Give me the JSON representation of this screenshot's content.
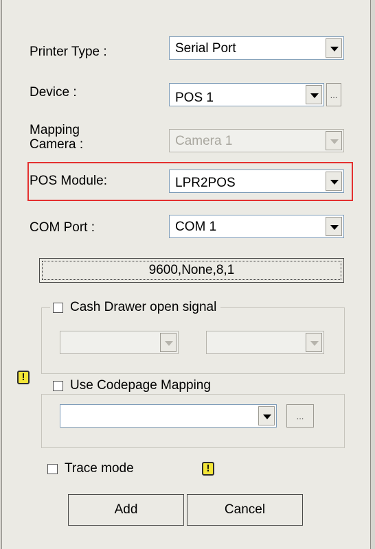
{
  "form": {
    "printer_type": {
      "label": "Printer Type :",
      "value": "Serial Port"
    },
    "device": {
      "label": "Device :",
      "value": "POS 1",
      "more": "..."
    },
    "mapping_camera": {
      "label_line1": "Mapping",
      "label_line2": "Camera :",
      "value": "Camera 1"
    },
    "pos_module": {
      "label": "POS Module:",
      "value": "LPR2POS"
    },
    "com_port": {
      "label": "COM Port :",
      "value": "COM 1"
    },
    "serial_settings_button": "9600,None,8,1",
    "cash_drawer": {
      "label": "Cash Drawer open signal"
    },
    "codepage": {
      "label": "Use Codepage Mapping",
      "more": "..."
    },
    "trace_mode": {
      "label": "Trace mode"
    },
    "warning_glyph": "!"
  },
  "buttons": {
    "add": "Add",
    "cancel": "Cancel"
  },
  "colors": {
    "highlight": "#e4302f",
    "warning": "#f3e638"
  }
}
